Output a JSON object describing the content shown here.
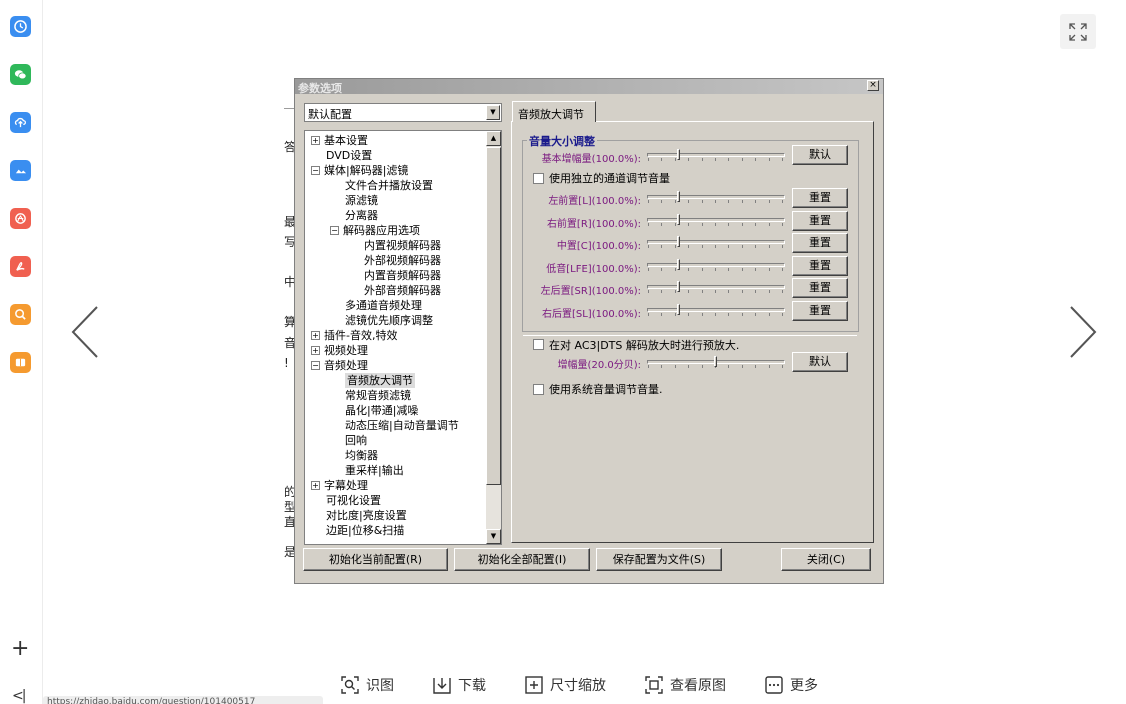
{
  "sidebar": {
    "apps": [
      {
        "icon": "clock-icon",
        "color": "#3a8ef0"
      },
      {
        "icon": "wechat-icon",
        "color": "#2fb85a"
      },
      {
        "icon": "upload-icon",
        "color": "#3a8ef0"
      },
      {
        "icon": "cloud-icon",
        "color": "#3a8ef0"
      },
      {
        "icon": "camera-icon",
        "color": "#f06050"
      },
      {
        "icon": "pdf-icon",
        "color": "#f06050"
      },
      {
        "icon": "search-icon",
        "color": "#f59a2f"
      },
      {
        "icon": "book-icon",
        "color": "#f59a2f"
      }
    ],
    "plus_label": "+",
    "collapse_label": "<|"
  },
  "url_bar_text": "https://zhidao.baidu.com/question/101400517",
  "viewer": {
    "toolbar": [
      {
        "label": "识图",
        "icon": "scan-icon"
      },
      {
        "label": "下载",
        "icon": "download-icon"
      },
      {
        "label": "尺寸缩放",
        "icon": "zoom-icon"
      },
      {
        "label": "查看原图",
        "icon": "original-icon"
      },
      {
        "label": "更多",
        "icon": "more-icon"
      }
    ]
  },
  "dialog": {
    "title": "参数选项",
    "combo_value": "默认配置",
    "tree": [
      {
        "label": "基本设置",
        "level": 0,
        "expander": "+"
      },
      {
        "label": "DVD设置",
        "level": 0,
        "expander": ""
      },
      {
        "label": "媒体|解码器|滤镜",
        "level": 0,
        "expander": "-"
      },
      {
        "label": "文件合并播放设置",
        "level": 1,
        "expander": ""
      },
      {
        "label": "源滤镜",
        "level": 1,
        "expander": ""
      },
      {
        "label": "分离器",
        "level": 1,
        "expander": ""
      },
      {
        "label": "解码器应用选项",
        "level": 1,
        "expander": "-"
      },
      {
        "label": "内置视频解码器",
        "level": 2,
        "expander": ""
      },
      {
        "label": "外部视频解码器",
        "level": 2,
        "expander": ""
      },
      {
        "label": "内置音频解码器",
        "level": 2,
        "expander": ""
      },
      {
        "label": "外部音频解码器",
        "level": 2,
        "expander": ""
      },
      {
        "label": "多通道音频处理",
        "level": 1,
        "expander": ""
      },
      {
        "label": "滤镜优先顺序调整",
        "level": 1,
        "expander": ""
      },
      {
        "label": "插件-音效,特效",
        "level": 0,
        "expander": "+"
      },
      {
        "label": "视频处理",
        "level": 0,
        "expander": "+"
      },
      {
        "label": "音频处理",
        "level": 0,
        "expander": "-"
      },
      {
        "label": "音频放大调节",
        "level": 1,
        "expander": "",
        "selected": true
      },
      {
        "label": "常规音频滤镜",
        "level": 1,
        "expander": ""
      },
      {
        "label": "晶化|带通|减噪",
        "level": 1,
        "expander": ""
      },
      {
        "label": "动态压缩|自动音量调节",
        "level": 1,
        "expander": ""
      },
      {
        "label": "回响",
        "level": 1,
        "expander": ""
      },
      {
        "label": "均衡器",
        "level": 1,
        "expander": ""
      },
      {
        "label": "重采样|输出",
        "level": 1,
        "expander": ""
      },
      {
        "label": "字幕处理",
        "level": 0,
        "expander": "+"
      },
      {
        "label": "可视化设置",
        "level": 0,
        "expander": ""
      },
      {
        "label": "对比度|亮度设置",
        "level": 0,
        "expander": ""
      },
      {
        "label": "边距|位移&扫描",
        "level": 0,
        "expander": ""
      }
    ],
    "tab_label": "音频放大调节",
    "group_title": "音量大小调整",
    "base_gain": {
      "label": "基本增幅量(100.0%):",
      "level": 0.22,
      "button": "默认"
    },
    "independent_check": {
      "label": "使用独立的通道调节音量",
      "checked": false
    },
    "channels": [
      {
        "label": "左前置[L](100.0%):",
        "level": 0.22,
        "button": "重置"
      },
      {
        "label": "右前置[R](100.0%):",
        "level": 0.22,
        "button": "重置"
      },
      {
        "label": "中置[C](100.0%):",
        "level": 0.22,
        "button": "重置"
      },
      {
        "label": "低音[LFE](100.0%):",
        "level": 0.22,
        "button": "重置"
      },
      {
        "label": "左后置[SR](100.0%):",
        "level": 0.22,
        "button": "重置"
      },
      {
        "label": "右后置[SL](100.0%):",
        "level": 0.22,
        "button": "重置"
      }
    ],
    "preamp_check": {
      "label": "在对 AC3|DTS 解码放大时进行预放大.",
      "checked": false
    },
    "boost": {
      "label": "增幅量(20.0分贝):",
      "level": 0.5,
      "button": "默认"
    },
    "system_volume_check": {
      "label": "使用系统音量调节音量.",
      "checked": false
    },
    "footer": {
      "init_current": "初始化当前配置(R)",
      "init_all": "初始化全部配置(I)",
      "save_to_file": "保存配置为文件(S)",
      "close": "关闭(C)"
    }
  },
  "background_fragments": [
    "答",
    "最",
    "写",
    "中",
    "算",
    "音",
    "!",
    "的",
    "型",
    "直",
    "是"
  ]
}
